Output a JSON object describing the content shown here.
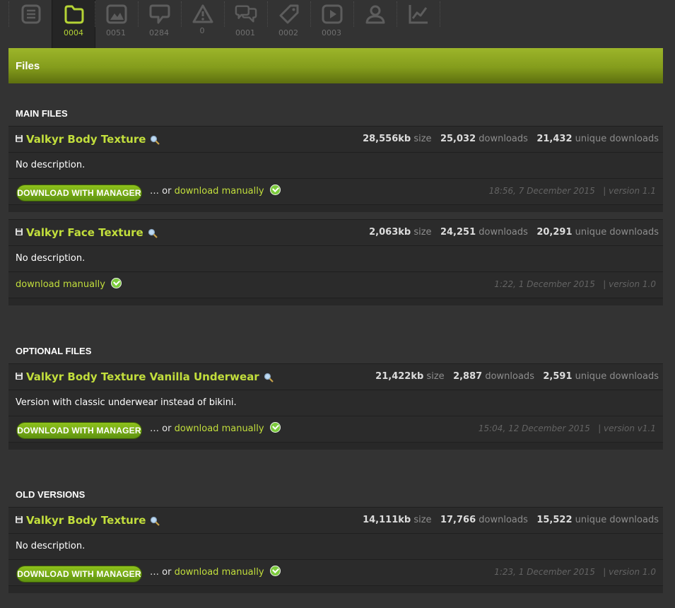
{
  "tabs": [
    {
      "icon": "description-icon",
      "count": ""
    },
    {
      "icon": "files-folder-icon",
      "count": "0004"
    },
    {
      "icon": "images-icon",
      "count": "0051"
    },
    {
      "icon": "posts-comment-icon",
      "count": "0284"
    },
    {
      "icon": "bugs-warning-icon",
      "count": "0"
    },
    {
      "icon": "forum-chat-icon",
      "count": "0001"
    },
    {
      "icon": "articles-tag-icon",
      "count": "0002"
    },
    {
      "icon": "videos-play-icon",
      "count": "0003"
    },
    {
      "icon": "users-person-icon",
      "count": ""
    },
    {
      "icon": "stats-chart-icon",
      "count": ""
    }
  ],
  "active_tab_index": 1,
  "accent_color": "#b5d335",
  "header": {
    "title": "Files"
  },
  "sections": {
    "main": {
      "title": "MAIN FILES",
      "files": [
        {
          "name": "Valkyr Body Texture",
          "size": "28,556kb",
          "size_label": "size",
          "downloads": "25,032",
          "downloads_label": "downloads",
          "unique": "21,432",
          "unique_label": "unique downloads",
          "description": "No description.",
          "manager_label": "DOWNLOAD WITH MANAGER",
          "or_text": "… or",
          "manual_label": "download manually",
          "date": "18:56, 7 December 2015",
          "version": "| version 1.1"
        },
        {
          "name": "Valkyr Face Texture",
          "size": "2,063kb",
          "size_label": "size",
          "downloads": "24,251",
          "downloads_label": "downloads",
          "unique": "20,291",
          "unique_label": "unique downloads",
          "description": "No description.",
          "manual_label": "download manually",
          "date": "1:22, 1 December 2015",
          "version": "| version 1.0"
        }
      ]
    },
    "optional": {
      "title": "OPTIONAL FILES",
      "files": [
        {
          "name": "Valkyr Body Texture Vanilla Underwear",
          "size": "21,422kb",
          "size_label": "size",
          "downloads": "2,887",
          "downloads_label": "downloads",
          "unique": "2,591",
          "unique_label": "unique downloads",
          "description": "Version with classic underwear instead of bikini.",
          "manager_label": "DOWNLOAD WITH MANAGER",
          "or_text": "… or",
          "manual_label": "download manually",
          "date": "15:04, 12 December 2015",
          "version": "| version v1.1"
        }
      ]
    },
    "old": {
      "title": "OLD VERSIONS",
      "files": [
        {
          "name": "Valkyr Body Texture",
          "size": "14,111kb",
          "size_label": "size",
          "downloads": "17,766",
          "downloads_label": "downloads",
          "unique": "15,522",
          "unique_label": "unique downloads",
          "description": "No description.",
          "manager_label": "DOWNLOAD WITH MANAGER",
          "or_text": "… or",
          "manual_label": "download manually",
          "date": "1:23, 1 December 2015",
          "version": "| version 1.0"
        }
      ]
    }
  }
}
